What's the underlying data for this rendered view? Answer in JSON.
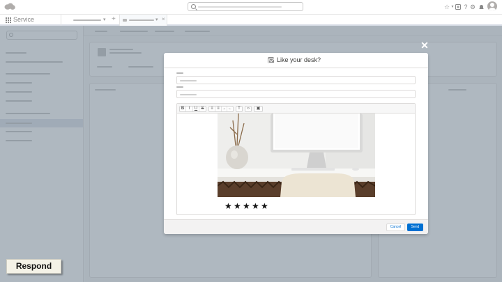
{
  "app": {
    "name": "Service"
  },
  "modal": {
    "title": "Like your desk?",
    "close_glyph": "✕",
    "icon": "email-icon",
    "footer": {
      "cancel_label": "Cancel",
      "send_label": "Send"
    },
    "rating": {
      "value": 5,
      "max": 5
    },
    "toolbar_icons": [
      "bold-icon",
      "italic-icon",
      "underline-icon",
      "strikethrough-icon",
      "bulleted-list-icon",
      "numbered-list-icon",
      "indent-icon",
      "outdent-icon",
      "clear-formatting-icon",
      "code-icon",
      "insert-image-icon"
    ]
  },
  "badge": {
    "label": "Respond"
  },
  "colors": {
    "brand": "#0070d2",
    "backdrop": "#7e8c99",
    "active_nav": "#d8dde6",
    "cloud_logo": "#b0adab"
  },
  "header_icons": [
    "salesforce-cloud-icon",
    "favorites-star-icon",
    "add-icon",
    "help-icon",
    "setup-gear-icon",
    "notifications-bell-icon",
    "user-avatar-icon"
  ]
}
